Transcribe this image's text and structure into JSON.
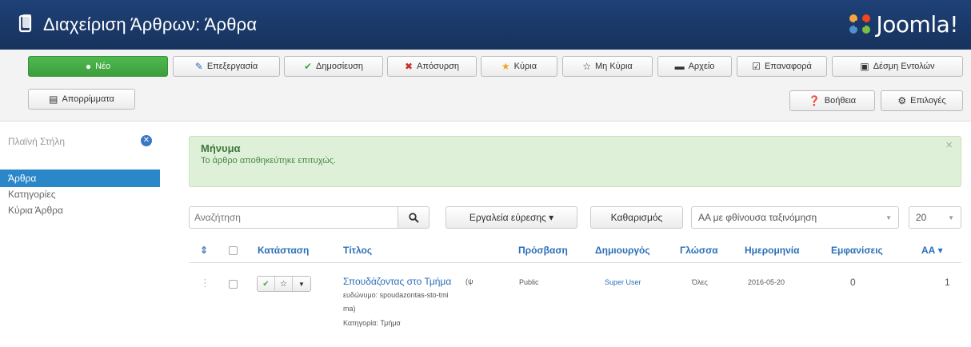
{
  "header": {
    "title": "Διαχείριση Άρθρων: Άρθρα",
    "brand": "Joomla!"
  },
  "toolbar": {
    "new": "Νέο",
    "edit": "Επεξεργασία",
    "publish": "Δημοσίευση",
    "unpublish": "Απόσυρση",
    "featured": "Κύρια",
    "unfeatured": "Μη Κύρια",
    "archive": "Αρχείο",
    "checkin": "Επαναφορά",
    "batch": "Δέσμη Εντολών",
    "trash": "Απορρίμματα",
    "help": "Βοήθεια",
    "options": "Επιλογές"
  },
  "sidebar": {
    "filter_label": "Πλαϊνή Στήλη",
    "items": [
      {
        "label": "Άρθρα",
        "active": true
      },
      {
        "label": "Κατηγορίες",
        "active": false
      },
      {
        "label": "Κύρια Άρθρα",
        "active": false
      }
    ]
  },
  "message": {
    "heading": "Μήνυμα",
    "body": "Το άρθρο αποθηκεύτηκε επιτυχώς.",
    "close": "×"
  },
  "filters": {
    "search_placeholder": "Αναζήτηση",
    "search_tools": "Εργαλεία εύρεσης ▾",
    "clear": "Καθαρισμός",
    "ordering": "ΑΑ με φθίνουσα ταξινόμηση",
    "limit": "20"
  },
  "table": {
    "columns": {
      "sort": "⇕",
      "status": "Κατάσταση",
      "title": "Τίτλος",
      "access": "Πρόσβαση",
      "author": "Δημιουργός",
      "language": "Γλώσσα",
      "date": "Ημερομηνία",
      "hits": "Εμφανίσεις",
      "id": "ΑΑ ▾"
    },
    "rows": [
      {
        "title": "Σπουδάζοντας στο Τμήμα",
        "alias_1": "(ψ",
        "alias_2": "ευδώνυμο: spoudazontas-sto-tmi",
        "alias_3": "ma)",
        "category": "Κατηγορία: Τμήμα",
        "access": "Public",
        "author": "Super User",
        "language": "Όλες",
        "date": "2016-05-20",
        "hits": "0",
        "id": "1"
      }
    ]
  },
  "colors": {
    "header_bg": "#1a3867",
    "new_button": "#46a546",
    "link": "#2a6fb8",
    "alert_bg": "#dff0d8",
    "sidebar_active": "#2a88c9"
  }
}
